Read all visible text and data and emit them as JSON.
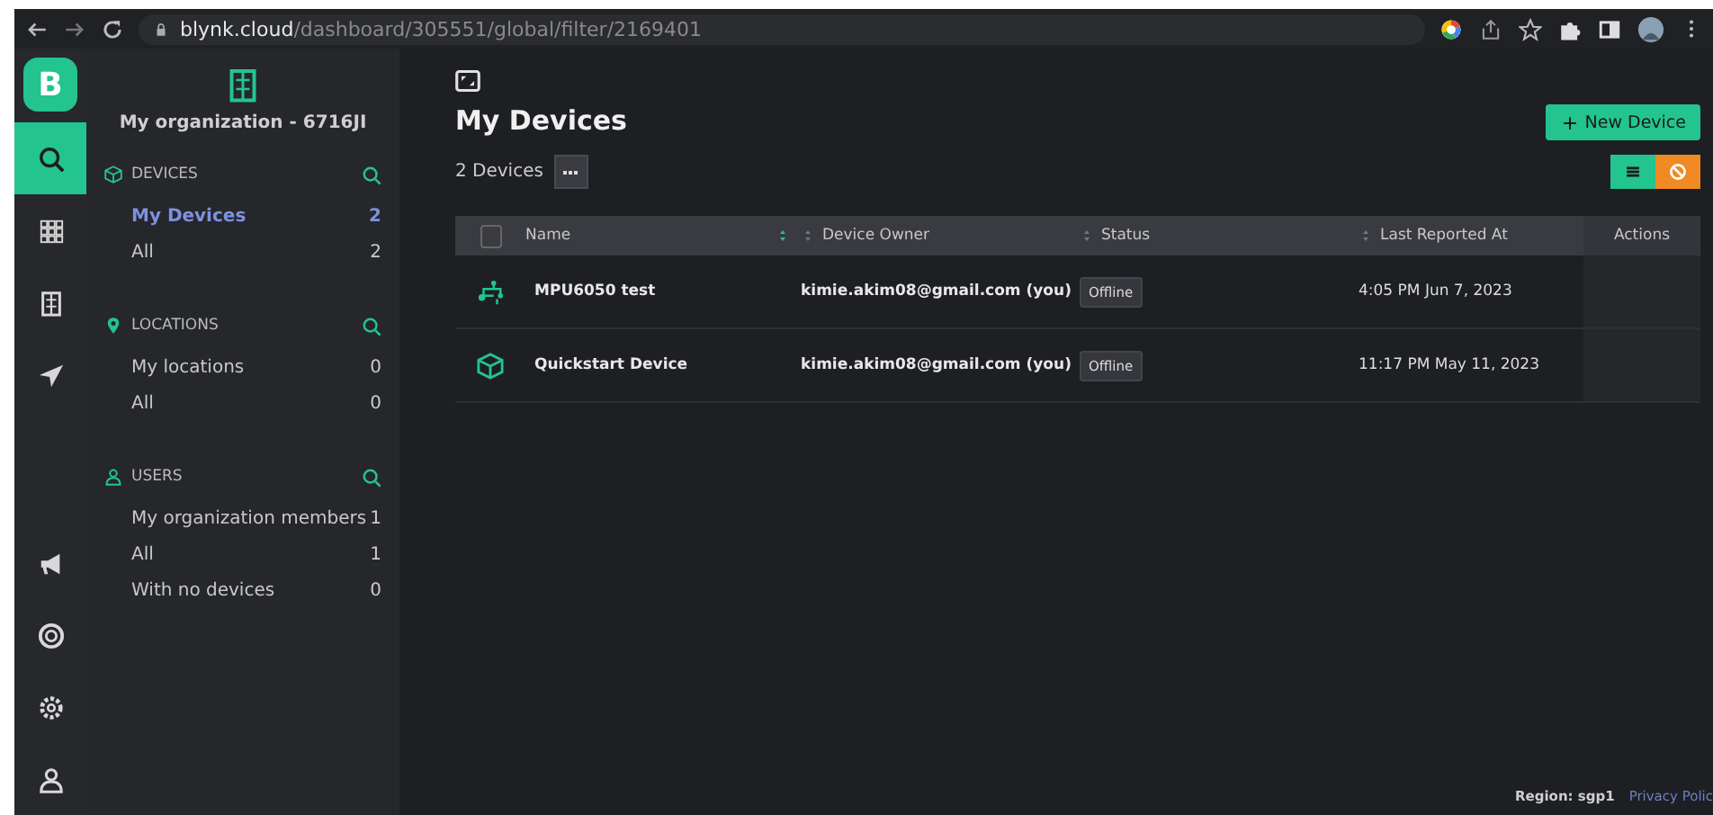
{
  "browser": {
    "url_domain": "blynk.cloud",
    "url_path": "/dashboard/305551/global/filter/2169401"
  },
  "rail": {
    "logo": "B",
    "items": [
      {
        "kind": "search",
        "selected": true
      },
      {
        "kind": "grid",
        "selected": false
      },
      {
        "kind": "building",
        "selected": false
      },
      {
        "kind": "send",
        "selected": false
      },
      {
        "kind": "megaphone",
        "selected": false
      },
      {
        "kind": "lifebuoy",
        "selected": false
      },
      {
        "kind": "settings",
        "selected": false
      },
      {
        "kind": "user",
        "selected": false
      }
    ]
  },
  "sidebar": {
    "org": "My organization - 6716JI",
    "sections": [
      {
        "kind": "devices",
        "title": "DEVICES",
        "items": [
          {
            "label": "My Devices",
            "count": "2",
            "selected": true
          },
          {
            "label": "All",
            "count": "2",
            "selected": false
          }
        ]
      },
      {
        "kind": "locations",
        "title": "LOCATIONS",
        "items": [
          {
            "label": "My locations",
            "count": "0",
            "selected": false
          },
          {
            "label": "All",
            "count": "0",
            "selected": false
          }
        ]
      },
      {
        "kind": "users",
        "title": "USERS",
        "items": [
          {
            "label": "My organization members",
            "count": "1",
            "selected": false
          },
          {
            "label": "All",
            "count": "1",
            "selected": false
          },
          {
            "label": "With no devices",
            "count": "0",
            "selected": false
          }
        ]
      }
    ]
  },
  "main": {
    "title": "My Devices",
    "count_label": "2 Devices",
    "new_button": "New Device",
    "views": [
      {
        "kind": "list",
        "color": "#23c48e"
      },
      {
        "kind": "map",
        "color": "#f08a24"
      }
    ],
    "table": {
      "select_all": {
        "checked": false
      },
      "columns": [
        {
          "label": "Name",
          "sorted": true
        },
        {
          "label": "Device Owner",
          "sorted": false
        },
        {
          "label": "Status",
          "sorted": false
        },
        {
          "label": "Last Reported At",
          "sorted": false
        },
        {
          "label": "Actions"
        }
      ],
      "rows": [
        {
          "kind": "circuit",
          "name": "MPU6050 test",
          "owner": "kimie.akim08@gmail.com (you)",
          "status": "Offline",
          "last_reported": "4:05 PM Jun 7, 2023"
        },
        {
          "kind": "cube",
          "name": "Quickstart Device",
          "owner": "kimie.akim08@gmail.com (you)",
          "status": "Offline",
          "last_reported": "11:17 PM May 11, 2023"
        }
      ]
    }
  },
  "footer": {
    "region": "Region: sgp1",
    "privacy": "Privacy Polic"
  }
}
